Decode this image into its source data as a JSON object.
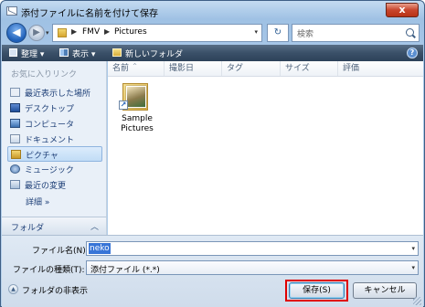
{
  "window": {
    "title": "添付ファイルに名前を付けて保存",
    "close_label": "x"
  },
  "nav": {
    "back_glyph": "◀",
    "forward_glyph": "▶",
    "breadcrumb": [
      "FMV",
      "Pictures"
    ],
    "separator": "▶",
    "refresh_glyph": "↻",
    "search_placeholder": "検索"
  },
  "toolbar": {
    "organize_label": "整理 ▾",
    "view_label": "表示 ▾",
    "new_folder_label": "新しいフォルダ",
    "help_glyph": "?"
  },
  "sidebar": {
    "favorites_heading": "お気に入りリンク",
    "items": [
      {
        "label": "最近表示した場所",
        "icon": "recent-places-icon"
      },
      {
        "label": "デスクトップ",
        "icon": "desktop-icon"
      },
      {
        "label": "コンピュータ",
        "icon": "computer-icon"
      },
      {
        "label": "ドキュメント",
        "icon": "documents-icon"
      },
      {
        "label": "ピクチャ",
        "icon": "pictures-icon",
        "selected": true
      },
      {
        "label": "ミュージック",
        "icon": "music-icon"
      },
      {
        "label": "最近の変更",
        "icon": "recently-changed-icon"
      }
    ],
    "more_label": "詳細 »",
    "folders_label": "フォルダ",
    "folders_chevron": "︿"
  },
  "filelist": {
    "columns": [
      "名前",
      "撮影日",
      "タグ",
      "サイズ",
      "評価"
    ],
    "sort_glyph": "^",
    "items": [
      {
        "name_line1": "Sample",
        "name_line2": "Pictures",
        "shortcut_glyph": "↗"
      }
    ]
  },
  "footer": {
    "filename_label": "ファイル名(N):",
    "filename_value": "neko",
    "filetype_label": "ファイルの種類(T):",
    "filetype_value": "添付ファイル (*.*)",
    "dropdown_glyph": "▾",
    "hide_folders_label": "フォルダの非表示",
    "hide_folders_glyph": "▲",
    "save_label": "保存(S)",
    "cancel_label": "キャンセル"
  },
  "colors": {
    "highlight_outline": "#e00000",
    "selection": "#3875d7"
  }
}
